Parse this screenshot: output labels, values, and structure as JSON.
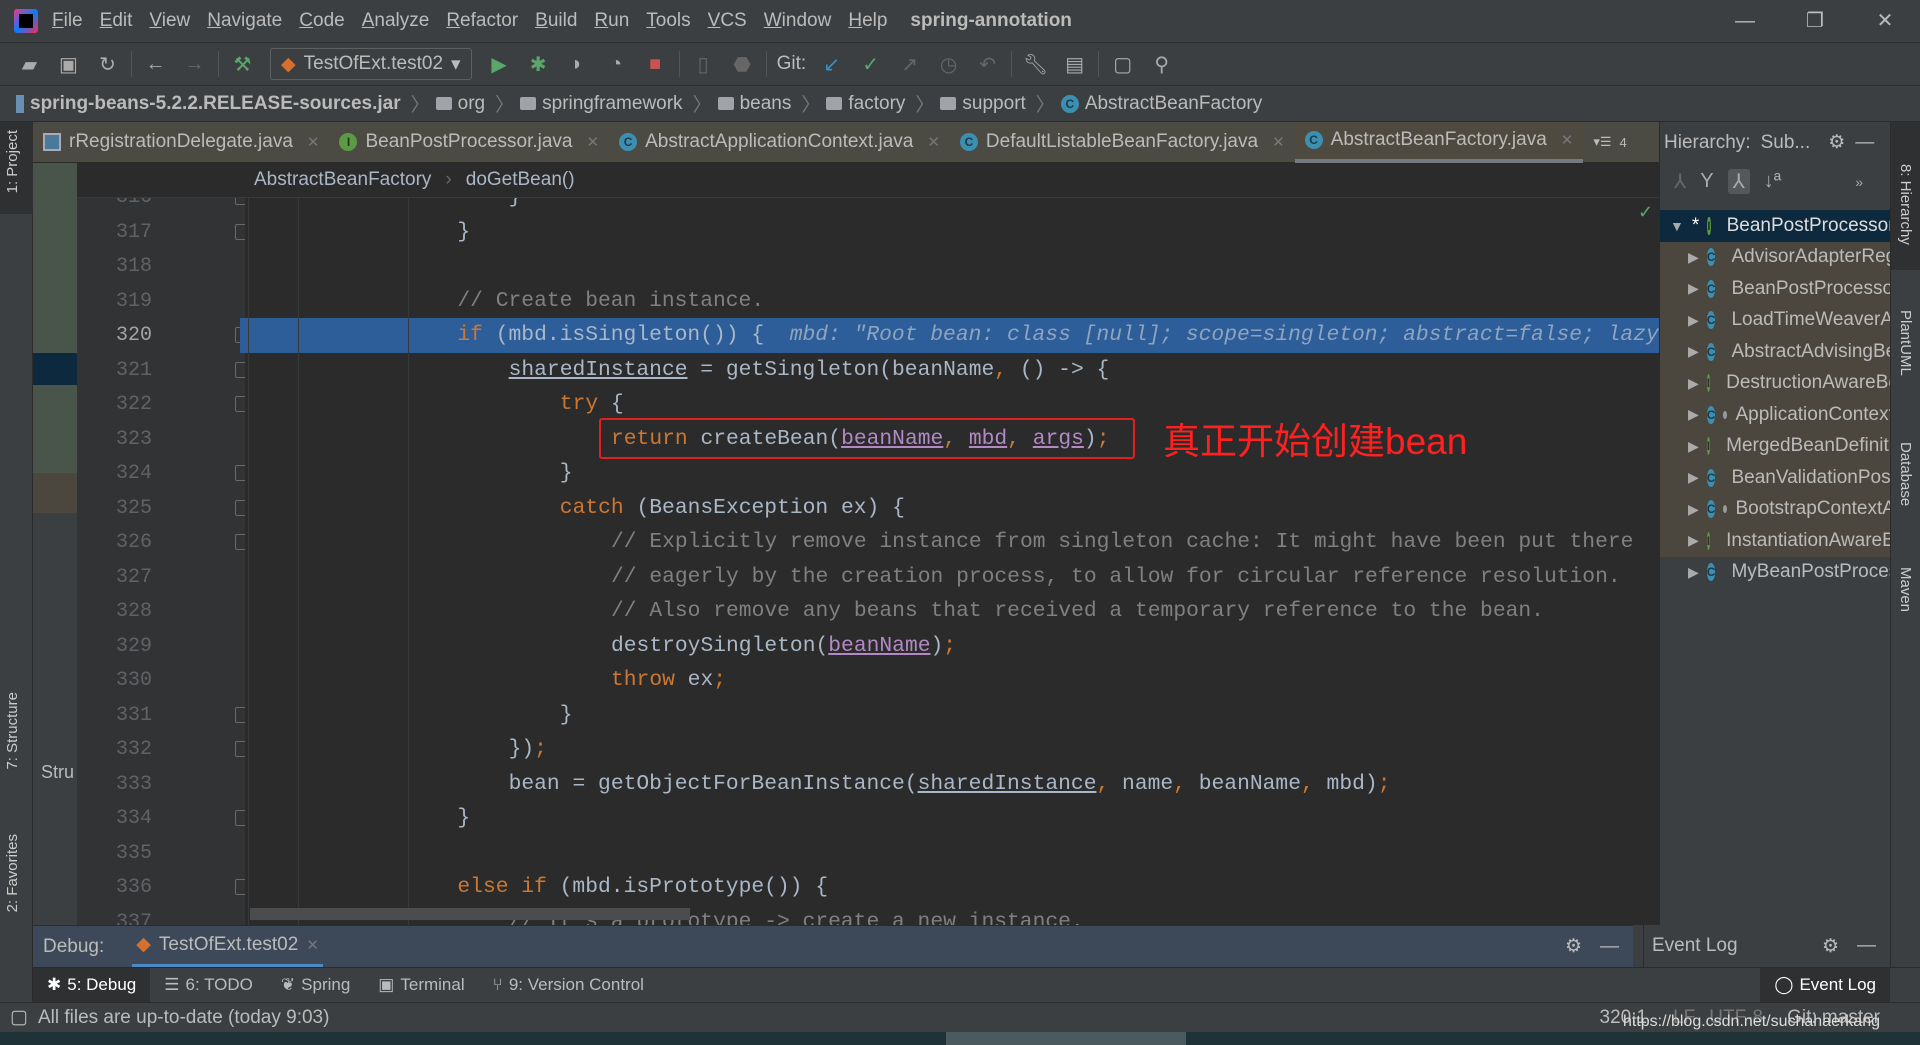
{
  "menubar": {
    "items": [
      "File",
      "Edit",
      "View",
      "Navigate",
      "Code",
      "Analyze",
      "Refactor",
      "Build",
      "Run",
      "Tools",
      "VCS",
      "Window",
      "Help"
    ],
    "project_title": "spring-annotation",
    "window_controls": [
      "—",
      "❐",
      "✕"
    ]
  },
  "toolbar": {
    "run_config": "TestOfExt.test02",
    "git_label": "Git:"
  },
  "navbar": {
    "crumbs": [
      "spring-beans-5.2.2.RELEASE-sources.jar",
      "org",
      "springframework",
      "beans",
      "factory",
      "support",
      "AbstractBeanFactory"
    ]
  },
  "tabs": [
    {
      "label": "rRegistrationDelegate.java",
      "icon": "file"
    },
    {
      "label": "BeanPostProcessor.java",
      "icon": "I"
    },
    {
      "label": "AbstractApplicationContext.java",
      "icon": "C"
    },
    {
      "label": "DefaultListableBeanFactory.java",
      "icon": "C"
    },
    {
      "label": "AbstractBeanFactory.java",
      "icon": "C",
      "active": true
    }
  ],
  "tabs_overflow": "4",
  "editor_breadcrumb": [
    "AbstractBeanFactory",
    "doGetBean()"
  ],
  "editor": {
    "current_line": 320,
    "lines": [
      {
        "n": 316,
        "i": 12,
        "t": [
          [
            "",
            "}"
          ]
        ]
      },
      {
        "n": 317,
        "i": 8,
        "t": [
          [
            "",
            "}"
          ]
        ]
      },
      {
        "n": 318,
        "i": 0,
        "t": []
      },
      {
        "n": 319,
        "i": 8,
        "t": [
          [
            "cm",
            "// Create bean instance."
          ]
        ]
      },
      {
        "n": 320,
        "i": 8,
        "t": [
          [
            "kw",
            "if"
          ],
          [
            "",
            " (mbd.isSingleton()) {  "
          ],
          [
            "hint",
            "mbd: \"Root bean: class [null]; scope=singleton; abstract=false; lazyInit=false\""
          ]
        ]
      },
      {
        "n": 321,
        "i": 12,
        "t": [
          [
            "ul",
            "sharedInstance"
          ],
          [
            "",
            " = getSingleton(beanName"
          ],
          [
            "kw",
            ","
          ],
          [
            "",
            " () -> {"
          ]
        ]
      },
      {
        "n": 322,
        "i": 16,
        "t": [
          [
            "kw",
            "try"
          ],
          [
            "",
            " {"
          ]
        ]
      },
      {
        "n": 323,
        "i": 20,
        "t": [
          [
            "kw",
            "return"
          ],
          [
            "",
            " createBean("
          ],
          [
            "pm",
            "beanName"
          ],
          [
            "kw",
            ","
          ],
          [
            "",
            " "
          ],
          [
            "pm",
            "mbd"
          ],
          [
            "kw",
            ","
          ],
          [
            "",
            " "
          ],
          [
            "pm",
            "args"
          ],
          [
            "",
            ")"
          ],
          [
            "kw",
            ";"
          ]
        ]
      },
      {
        "n": 324,
        "i": 16,
        "t": [
          [
            "",
            "}"
          ]
        ]
      },
      {
        "n": 325,
        "i": 16,
        "t": [
          [
            "kw",
            "catch"
          ],
          [
            "",
            " (BeansException ex) {"
          ]
        ]
      },
      {
        "n": 326,
        "i": 20,
        "t": [
          [
            "cm",
            "// Explicitly remove instance from singleton cache: It might have been put there"
          ]
        ]
      },
      {
        "n": 327,
        "i": 20,
        "t": [
          [
            "cm",
            "// eagerly by the creation process, to allow for circular reference resolution."
          ]
        ]
      },
      {
        "n": 328,
        "i": 20,
        "t": [
          [
            "cm",
            "// Also remove any beans that received a temporary reference to the bean."
          ]
        ]
      },
      {
        "n": 329,
        "i": 20,
        "t": [
          [
            "",
            "destroySingleton("
          ],
          [
            "pm",
            "beanName"
          ],
          [
            "",
            ")"
          ],
          [
            "kw",
            ";"
          ]
        ]
      },
      {
        "n": 330,
        "i": 20,
        "t": [
          [
            "kw",
            "throw"
          ],
          [
            "",
            " ex"
          ],
          [
            "kw",
            ";"
          ]
        ]
      },
      {
        "n": 331,
        "i": 16,
        "t": [
          [
            "",
            "}"
          ]
        ]
      },
      {
        "n": 332,
        "i": 12,
        "t": [
          [
            "",
            "})"
          ],
          [
            "kw",
            ";"
          ]
        ]
      },
      {
        "n": 333,
        "i": 12,
        "t": [
          [
            "",
            "bean = getObjectForBeanInstance("
          ],
          [
            "ul",
            "sharedInstance"
          ],
          [
            "kw",
            ","
          ],
          [
            "",
            " name"
          ],
          [
            "kw",
            ","
          ],
          [
            "",
            " beanName"
          ],
          [
            "kw",
            ","
          ],
          [
            "",
            " mbd)"
          ],
          [
            "kw",
            ";"
          ]
        ]
      },
      {
        "n": 334,
        "i": 8,
        "t": [
          [
            "",
            "}"
          ]
        ]
      },
      {
        "n": 335,
        "i": 0,
        "t": []
      },
      {
        "n": 336,
        "i": 8,
        "t": [
          [
            "kw",
            "else if"
          ],
          [
            "",
            " (mbd.isPrototype()) {"
          ]
        ]
      },
      {
        "n": 337,
        "i": 12,
        "t": [
          [
            "cm",
            "// It's a prototype -> create a new instance."
          ]
        ]
      }
    ]
  },
  "annotation": "真正开始创建bean",
  "hierarchy": {
    "title": "Hierarchy:",
    "subtitle": "Sub...",
    "items": [
      {
        "label": "BeanPostProcessor",
        "kind": "I",
        "access": "public",
        "root": true
      },
      {
        "label": "AdvisorAdapterRegistrationManager",
        "kind": "C",
        "access": "public"
      },
      {
        "label": "BeanPostProcessorChecker",
        "kind": "C",
        "access": "private"
      },
      {
        "label": "LoadTimeWeaverAwareProcessor",
        "kind": "C",
        "access": "public"
      },
      {
        "label": "AbstractAdvisingBeanPostProcessor",
        "kind": "C",
        "access": "public"
      },
      {
        "label": "DestructionAwareBeanPostProcessor",
        "kind": "I",
        "access": "public"
      },
      {
        "label": "ApplicationContextAwareProcessor",
        "kind": "C",
        "access": "package"
      },
      {
        "label": "MergedBeanDefinitionPostProcessor",
        "kind": "I",
        "access": "public"
      },
      {
        "label": "BeanValidationPostProcessor",
        "kind": "C",
        "access": "public"
      },
      {
        "label": "BootstrapContextAwareProcessor",
        "kind": "C",
        "access": "package"
      },
      {
        "label": "InstantiationAwareBeanPostProcessor",
        "kind": "I",
        "access": "public"
      },
      {
        "label": "MyBeanPostProcessor",
        "kind": "C",
        "access": "public",
        "plain": true
      }
    ]
  },
  "left_tabs": [
    "1: Project",
    "7: Structure",
    "2: Favorites"
  ],
  "structure_label": "Stru",
  "right_tabs": [
    "8: Hierarchy",
    "PlantUML",
    "Database",
    "Maven"
  ],
  "debug": {
    "label": "Debug:",
    "session": "TestOfExt.test02"
  },
  "event_log": "Event Log",
  "tool_tabs": [
    "5: Debug",
    "6: TODO",
    "Spring",
    "Terminal",
    "9: Version Control"
  ],
  "status": {
    "message": "All files are up-to-date (today 9:03)",
    "position": "320:1",
    "line_sep": "LF",
    "encoding": "UTF-8",
    "git": "Git: master",
    "watermark": "https://blog.csdn.net/suchahaerkang"
  }
}
